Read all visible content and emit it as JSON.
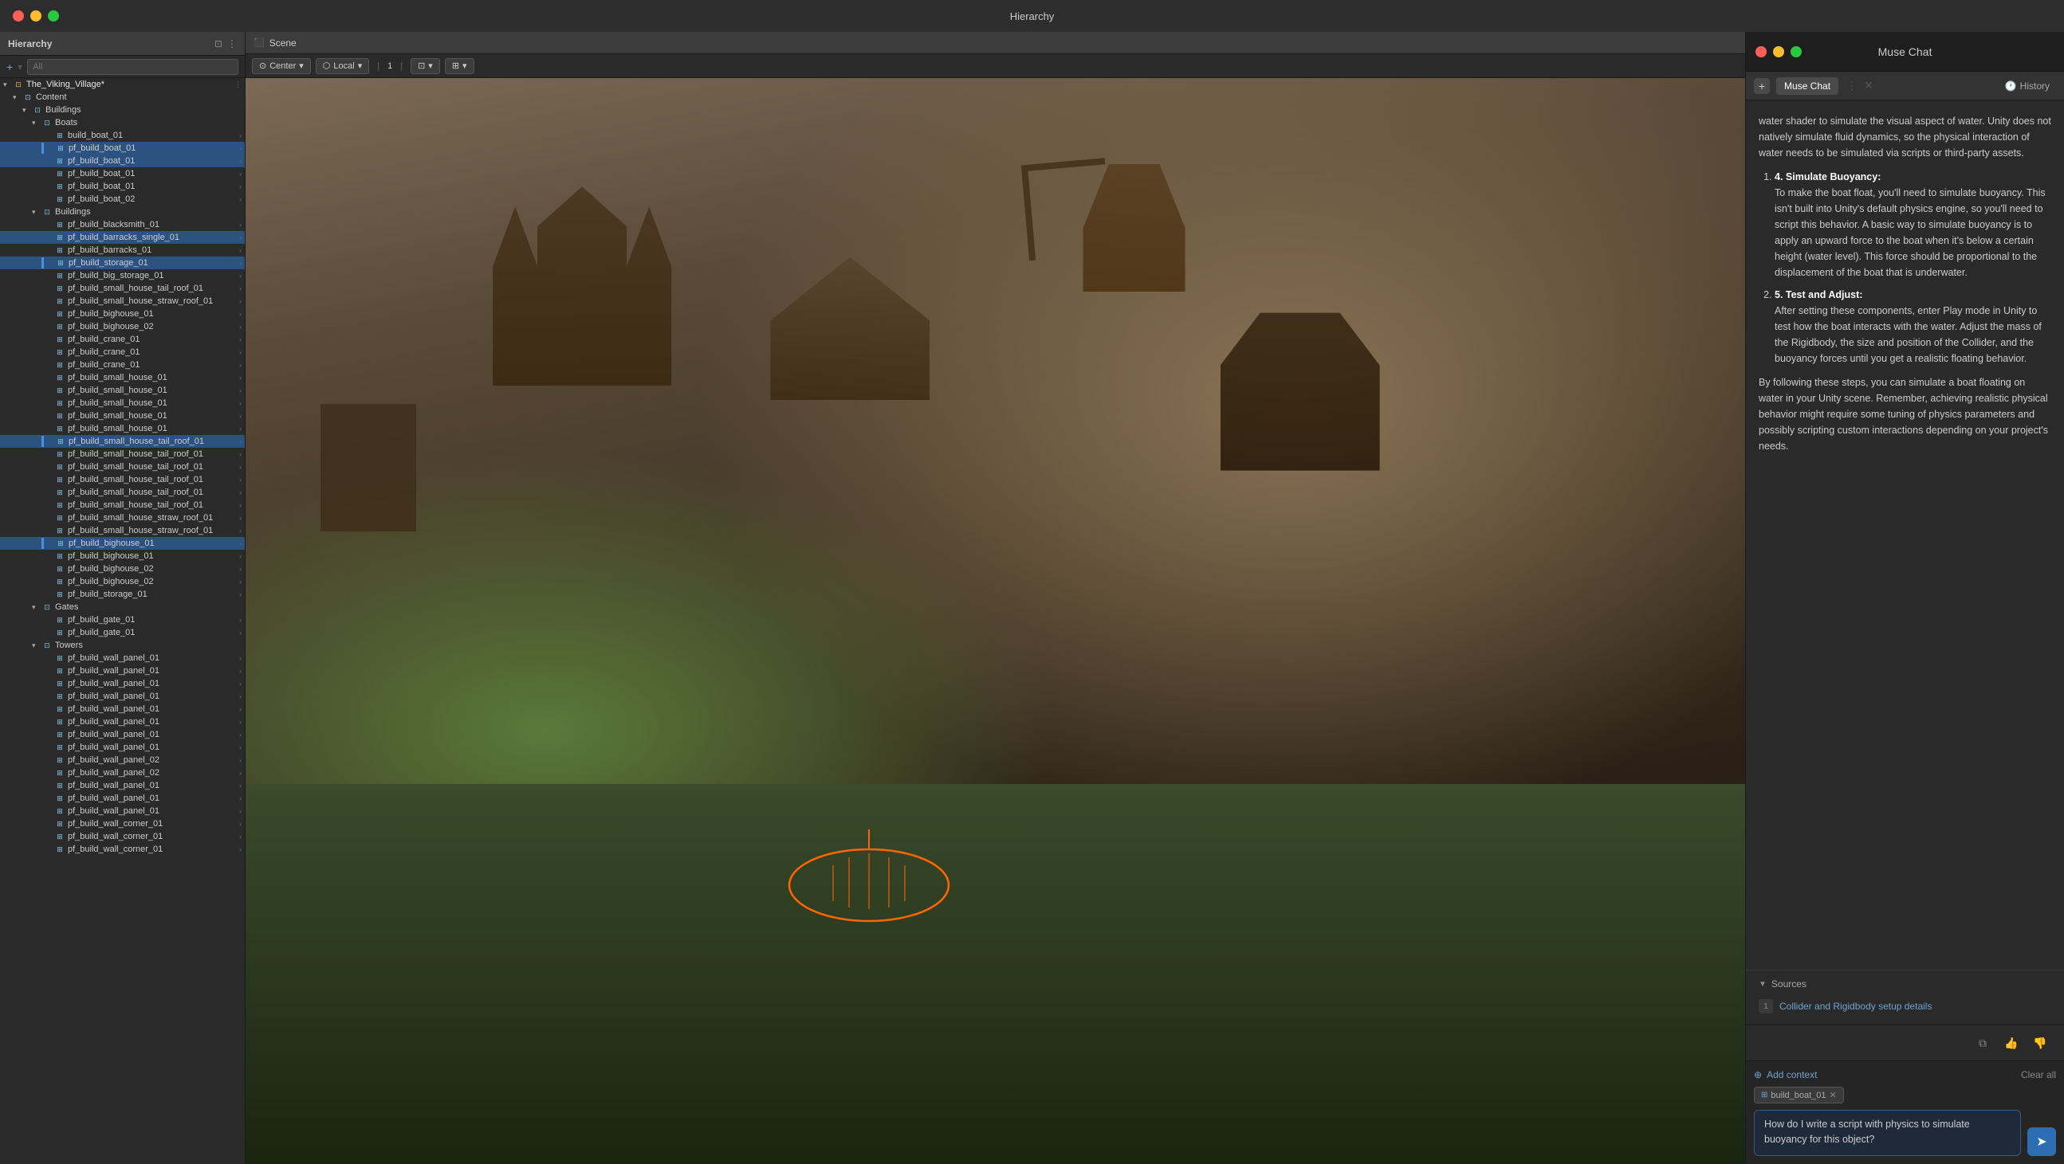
{
  "titlebar": {
    "title": "Hierarchy"
  },
  "hierarchy": {
    "panel_title": "Hierarchy",
    "search_placeholder": "All",
    "root": "The_Viking_Village*",
    "items": [
      {
        "label": "Content",
        "depth": 1,
        "type": "folder",
        "expanded": true
      },
      {
        "label": "Buildings",
        "depth": 2,
        "type": "folder",
        "expanded": true
      },
      {
        "label": "Boats",
        "depth": 3,
        "type": "folder",
        "expanded": true
      },
      {
        "label": "build_boat_01",
        "depth": 4,
        "type": "prefab",
        "selected": false
      },
      {
        "label": "pf_build_boat_01",
        "depth": 4,
        "type": "prefab",
        "selected": true,
        "active": true
      },
      {
        "label": "pf_build_boat_01",
        "depth": 4,
        "type": "prefab",
        "selected": true
      },
      {
        "label": "pf_build_boat_01",
        "depth": 4,
        "type": "prefab",
        "selected": false
      },
      {
        "label": "pf_build_boat_01",
        "depth": 4,
        "type": "prefab",
        "selected": false
      },
      {
        "label": "pf_build_boat_02",
        "depth": 4,
        "type": "prefab",
        "selected": false
      },
      {
        "label": "Buildings",
        "depth": 3,
        "type": "folder",
        "expanded": true
      },
      {
        "label": "pf_build_blacksmith_01",
        "depth": 4,
        "type": "prefab",
        "selected": false
      },
      {
        "label": "pf_build_barracks_single_01",
        "depth": 4,
        "type": "prefab",
        "selected": true
      },
      {
        "label": "pf_build_barracks_01",
        "depth": 4,
        "type": "prefab",
        "selected": false
      },
      {
        "label": "pf_build_storage_01",
        "depth": 4,
        "type": "prefab",
        "selected": true,
        "active": true
      },
      {
        "label": "pf_build_big_storage_01",
        "depth": 4,
        "type": "prefab",
        "selected": false
      },
      {
        "label": "pf_build_small_house_tail_roof_01",
        "depth": 4,
        "type": "prefab",
        "selected": false
      },
      {
        "label": "pf_build_small_house_straw_roof_01",
        "depth": 4,
        "type": "prefab",
        "selected": false
      },
      {
        "label": "pf_build_bighouse_01",
        "depth": 4,
        "type": "prefab",
        "selected": false
      },
      {
        "label": "pf_build_bighouse_02",
        "depth": 4,
        "type": "prefab",
        "selected": false
      },
      {
        "label": "pf_build_crane_01",
        "depth": 4,
        "type": "prefab",
        "selected": false
      },
      {
        "label": "pf_build_crane_01",
        "depth": 4,
        "type": "prefab",
        "selected": false
      },
      {
        "label": "pf_build_crane_01",
        "depth": 4,
        "type": "prefab",
        "selected": false
      },
      {
        "label": "pf_build_small_house_01",
        "depth": 4,
        "type": "prefab",
        "selected": false
      },
      {
        "label": "pf_build_small_house_01",
        "depth": 4,
        "type": "prefab",
        "selected": false
      },
      {
        "label": "pf_build_small_house_01",
        "depth": 4,
        "type": "prefab",
        "selected": false
      },
      {
        "label": "pf_build_small_house_01",
        "depth": 4,
        "type": "prefab",
        "selected": false
      },
      {
        "label": "pf_build_small_house_01",
        "depth": 4,
        "type": "prefab",
        "selected": false
      },
      {
        "label": "pf_build_small_house_tail_roof_01",
        "depth": 4,
        "type": "prefab",
        "selected": true,
        "active": true
      },
      {
        "label": "pf_build_small_house_tail_roof_01",
        "depth": 4,
        "type": "prefab",
        "selected": false
      },
      {
        "label": "pf_build_small_house_tail_roof_01",
        "depth": 4,
        "type": "prefab",
        "selected": false
      },
      {
        "label": "pf_build_small_house_tail_roof_01",
        "depth": 4,
        "type": "prefab",
        "selected": false
      },
      {
        "label": "pf_build_small_house_tail_roof_01",
        "depth": 4,
        "type": "prefab",
        "selected": false
      },
      {
        "label": "pf_build_small_house_tail_roof_01",
        "depth": 4,
        "type": "prefab",
        "selected": false
      },
      {
        "label": "pf_build_small_house_straw_roof_01",
        "depth": 4,
        "type": "prefab",
        "selected": false
      },
      {
        "label": "pf_build_small_house_straw_roof_01",
        "depth": 4,
        "type": "prefab",
        "selected": false
      },
      {
        "label": "pf_build_bighouse_01",
        "depth": 4,
        "type": "prefab",
        "selected": true,
        "active": true
      },
      {
        "label": "pf_build_bighouse_01",
        "depth": 4,
        "type": "prefab",
        "selected": false
      },
      {
        "label": "pf_build_bighouse_02",
        "depth": 4,
        "type": "prefab",
        "selected": false
      },
      {
        "label": "pf_build_bighouse_02",
        "depth": 4,
        "type": "prefab",
        "selected": false
      },
      {
        "label": "pf_build_storage_01",
        "depth": 4,
        "type": "prefab",
        "selected": false
      },
      {
        "label": "Gates",
        "depth": 3,
        "type": "folder",
        "expanded": true
      },
      {
        "label": "pf_build_gate_01",
        "depth": 4,
        "type": "prefab",
        "selected": false
      },
      {
        "label": "pf_build_gate_01",
        "depth": 4,
        "type": "prefab",
        "selected": false
      },
      {
        "label": "Towers",
        "depth": 3,
        "type": "folder",
        "expanded": true
      },
      {
        "label": "pf_build_wall_panel_01",
        "depth": 4,
        "type": "prefab",
        "selected": false
      },
      {
        "label": "pf_build_wall_panel_01",
        "depth": 4,
        "type": "prefab",
        "selected": false
      },
      {
        "label": "pf_build_wall_panel_01",
        "depth": 4,
        "type": "prefab",
        "selected": false
      },
      {
        "label": "pf_build_wall_panel_01",
        "depth": 4,
        "type": "prefab",
        "selected": false
      },
      {
        "label": "pf_build_wall_panel_01",
        "depth": 4,
        "type": "prefab",
        "selected": false
      },
      {
        "label": "pf_build_wall_panel_01",
        "depth": 4,
        "type": "prefab",
        "selected": false
      },
      {
        "label": "pf_build_wall_panel_01",
        "depth": 4,
        "type": "prefab",
        "selected": false
      },
      {
        "label": "pf_build_wall_panel_01",
        "depth": 4,
        "type": "prefab",
        "selected": false
      },
      {
        "label": "pf_build_wall_panel_02",
        "depth": 4,
        "type": "prefab",
        "selected": false
      },
      {
        "label": "pf_build_wall_panel_02",
        "depth": 4,
        "type": "prefab",
        "selected": false
      },
      {
        "label": "pf_build_wall_panel_01",
        "depth": 4,
        "type": "prefab",
        "selected": false
      },
      {
        "label": "pf_build_wall_panel_01",
        "depth": 4,
        "type": "prefab",
        "selected": false
      },
      {
        "label": "pf_build_wall_panel_01",
        "depth": 4,
        "type": "prefab",
        "selected": false
      },
      {
        "label": "pf_build_wall_corner_01",
        "depth": 4,
        "type": "prefab",
        "selected": false
      },
      {
        "label": "pf_build_wall_corner_01",
        "depth": 4,
        "type": "prefab",
        "selected": false
      },
      {
        "label": "pf_build_wall_corner_01",
        "depth": 4,
        "type": "prefab",
        "selected": false
      }
    ]
  },
  "scene": {
    "title": "Scene",
    "center_mode": "Center",
    "pivot_mode": "Local",
    "layer_number": "1"
  },
  "muse_chat": {
    "window_title": "Muse Chat",
    "tab_label": "Muse Chat",
    "history_label": "History",
    "add_context_label": "Add context",
    "clear_all_label": "Clear all",
    "context_tag": "build_boat_01",
    "input_value": "How do I write a script with physics to simulate buoyancy for this object?",
    "send_button_label": "Send",
    "sources_label": "Sources",
    "source_1_label": "Collider and Rigidbody setup details",
    "message_content": {
      "intro": "water shader to simulate the visual aspect of water. Unity does not natively simulate fluid dynamics, so the physical interaction of water needs to be simulated via scripts or third-party assets.",
      "step4_title": "4. Simulate Buoyancy:",
      "step4_body": "To make the boat float, you'll need to simulate buoyancy. This isn't built into Unity's default physics engine, so you'll need to script this behavior. A basic way to simulate buoyancy is to apply an upward force to the boat when it's below a certain height (water level). This force should be proportional to the displacement of the boat that is underwater.",
      "step5_title": "5. Test and Adjust:",
      "step5_body": "After setting these components, enter Play mode in Unity to test how the boat interacts with the water. Adjust the mass of the Rigidbody, the size and position of the Collider, and the buoyancy forces until you get a realistic floating behavior.",
      "conclusion": "By following these steps, you can simulate a boat floating on water in your Unity scene. Remember, achieving realistic physical behavior might require some tuning of physics parameters and possibly scripting custom interactions depending on your project's needs."
    },
    "action_copy": "Copy",
    "action_thumbup": "Thumbs up",
    "action_thumbdown": "Thumbs down"
  },
  "tools": {
    "hand": "✋",
    "move": "✥",
    "rotate": "↻",
    "scale": "⊡",
    "rect": "⬜",
    "transform": "⊞"
  }
}
